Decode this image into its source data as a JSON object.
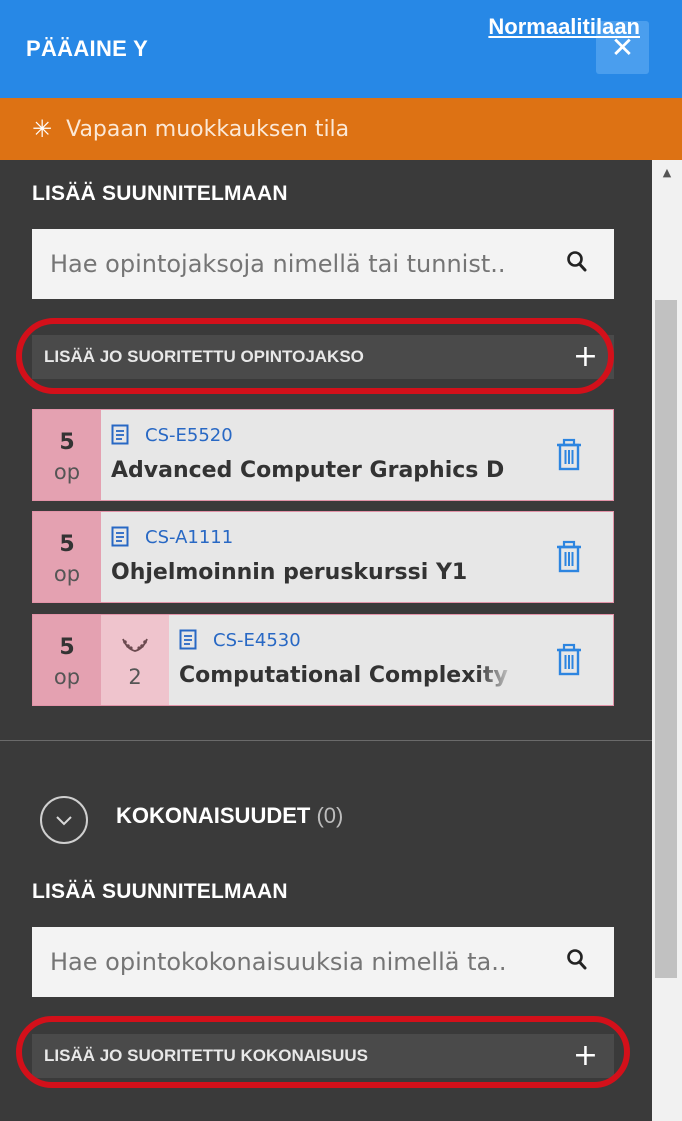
{
  "header": {
    "title": "PÄÄAINE Y",
    "close_label": "✕"
  },
  "banner": {
    "icon": "asterisk-burst-icon",
    "text": "Vapaan muokkauksen tila",
    "link": "Normaalitilaan"
  },
  "courses_section": {
    "add_label": "LISÄÄ SUUNNITELMAAN",
    "search_placeholder": "Hae opintojaksoja nimellä tai tunnist..",
    "add_done_label": "LISÄÄ JO SUORITETTU OPINTOJAKSO",
    "plus": "+",
    "items": [
      {
        "credits": "5",
        "unit": "op",
        "code": "CS-E5520",
        "name": "Advanced Computer Graphics D",
        "grade": null
      },
      {
        "credits": "5",
        "unit": "op",
        "code": "CS-A1111",
        "name": "Ohjelmoinnin peruskurssi Y1",
        "grade": null
      },
      {
        "credits": "5",
        "unit": "op",
        "code": "CS-E4530",
        "name": "Computational Complexity Th",
        "grade": "2"
      }
    ]
  },
  "modules_section": {
    "title": "KOKONAISUUDET",
    "count": "(0)",
    "add_label": "LISÄÄ SUUNNITELMAAN",
    "search_placeholder": "Hae opintokokonaisuuksia nimellä ta..",
    "add_done_label": "LISÄÄ JO SUORITETTU KOKONAISUUS",
    "plus": "+"
  },
  "colors": {
    "header": "#2788e6",
    "banner": "#dd7214",
    "panel": "#3a3a3a",
    "credits_cell": "#e4a1b1",
    "code_link": "#2868c4",
    "annotation": "#d3101a"
  }
}
